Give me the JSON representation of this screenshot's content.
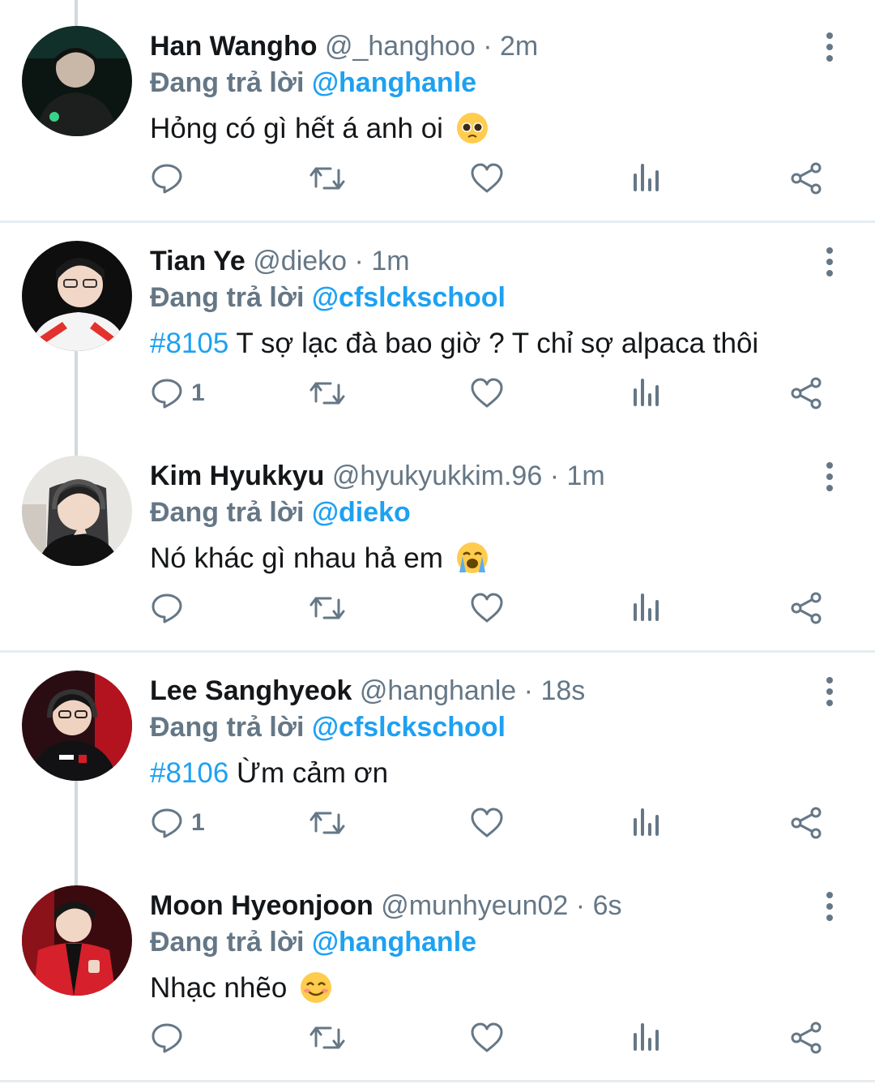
{
  "tweets": [
    {
      "name": "Han Wangho",
      "handle": "@_hanghoo",
      "dot": "·",
      "time": "2m",
      "reply_prefix": "Đang trả lời",
      "reply_to": "@hanghanle",
      "hashtag": "",
      "text": "Hỏng có gì hết á anh oi",
      "emoji": "pleading-face",
      "reply_count": ""
    },
    {
      "name": "Tian Ye",
      "handle": "@dieko",
      "dot": "·",
      "time": "1m",
      "reply_prefix": "Đang trả lời",
      "reply_to": "@cfslckschool",
      "hashtag": "#8105",
      "text": " T sợ lạc đà bao giờ ? T chỉ sợ alpaca thôi",
      "emoji": "",
      "reply_count": "1"
    },
    {
      "name": "Kim Hyukkyu",
      "handle": "@hyukyukkim.96",
      "dot": "·",
      "time": "1m",
      "reply_prefix": "Đang trả lời",
      "reply_to": "@dieko",
      "hashtag": "",
      "text": "Nó khác gì nhau hả em",
      "emoji": "loudly-crying-face",
      "reply_count": ""
    },
    {
      "name": "Lee Sanghyeok",
      "handle": "@hanghanle",
      "dot": "·",
      "time": "18s",
      "reply_prefix": "Đang trả lời",
      "reply_to": "@cfslckschool",
      "hashtag": "#8106",
      "text": " Ừm cảm ơn",
      "emoji": "",
      "reply_count": "1"
    },
    {
      "name": "Moon Hyeonjoon",
      "handle": "@munhyeun02",
      "dot": "·",
      "time": "6s",
      "reply_prefix": "Đang trả lời",
      "reply_to": "@hanghanle",
      "hashtag": "",
      "text": "Nhạc nhẽo",
      "emoji": "smiling-face",
      "reply_count": ""
    }
  ],
  "colors": {
    "accent": "#1da1f2",
    "muted": "#657786",
    "text": "#14171a",
    "divider": "#e6ecf0"
  },
  "icons": [
    "reply-icon",
    "retweet-icon",
    "like-icon",
    "analytics-icon",
    "share-icon",
    "more-icon"
  ]
}
